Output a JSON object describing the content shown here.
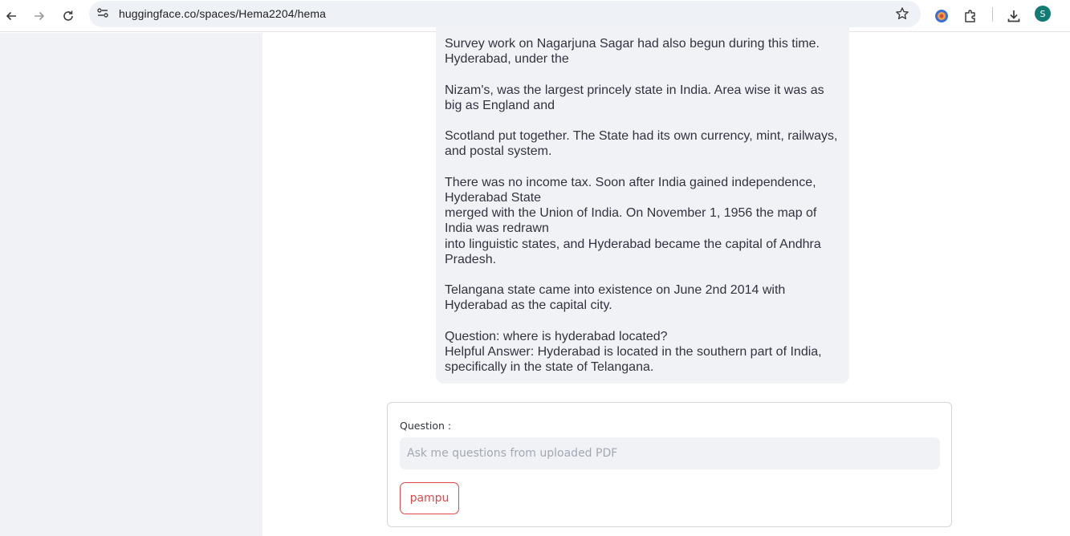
{
  "browser": {
    "url": "huggingface.co/spaces/Hema2204/hema",
    "avatar_letter": "S",
    "avatar_color": "#127b73",
    "icons": [
      "back-icon",
      "forward-icon",
      "reload-icon",
      "site-info-icon",
      "bookmark-star-icon",
      "extension-colorful-icon",
      "extensions-puzzle-icon",
      "download-icon"
    ]
  },
  "chat": {
    "response": "Survey work on Nagarjuna Sagar had also begun during this time.\nHyderabad, under the\n\nNizam's, was the largest princely state in India. Area wise it was as\nbig as England and\n\nScotland put together. The State had its own currency, mint, railways,\nand postal system.\n\nThere was no income tax. Soon after India gained independence,\nHyderabad State\nmerged with the Union of India. On November 1, 1956 the map of\nIndia was redrawn\ninto linguistic states, and Hyderabad became the capital of Andhra\nPradesh.\n\nTelangana state came into existence on June 2nd 2014 with\nHyderabad as the capital city.\n\nQuestion: where is hyderabad located?\nHelpful Answer: Hyderabad is located in the southern part of India,\nspecifically in the state of Telangana."
  },
  "form": {
    "label": "Question :",
    "placeholder": "Ask me questions from uploaded PDF",
    "value": "",
    "submit_label": "pampu",
    "accent_color": "#e04848"
  }
}
